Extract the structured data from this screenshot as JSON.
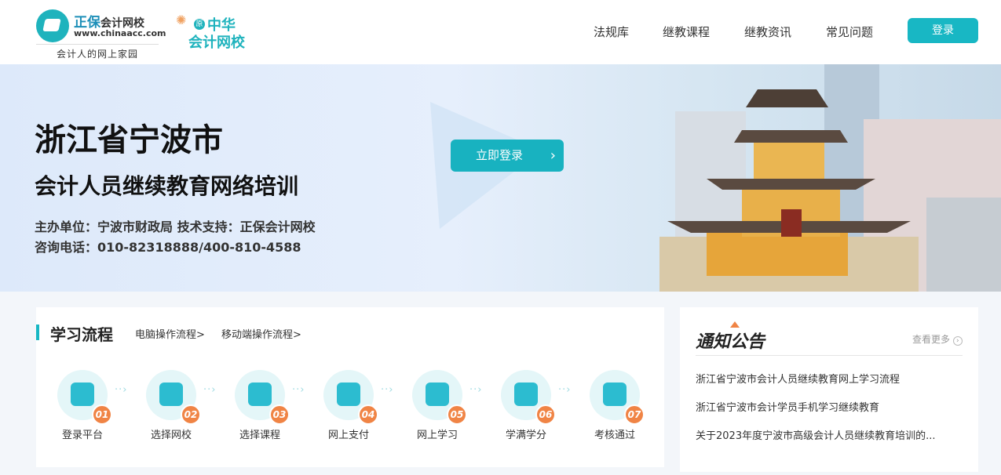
{
  "header": {
    "logo": {
      "brand": "正保",
      "brand_suffix": "会计网校",
      "url": "www.chinaacc.com",
      "slogan": "会计人的网上家园"
    },
    "sub_logo": {
      "badge": "原",
      "line1": "中华",
      "line2": "会计网校"
    },
    "nav": [
      "法规库",
      "继教课程",
      "继教资讯",
      "常见问题"
    ],
    "login_label": "登录"
  },
  "banner": {
    "title": "浙江省宁波市",
    "subtitle": "会计人员继续教育网络培训",
    "sponsor": "主办单位：宁波市财政局  技术支持：正保会计网校",
    "phone": "咨询电话：010-82318888/400-810-4588",
    "cta": "立即登录"
  },
  "process": {
    "title": "学习流程",
    "links": [
      "电脑操作流程>",
      "移动端操作流程>"
    ],
    "steps": [
      {
        "num": "01",
        "label": "登录平台",
        "icon": "user-icon"
      },
      {
        "num": "02",
        "label": "选择网校",
        "icon": "scroll-icon"
      },
      {
        "num": "03",
        "label": "选择课程",
        "icon": "calendar-icon"
      },
      {
        "num": "04",
        "label": "网上支付",
        "icon": "shield-check-icon"
      },
      {
        "num": "05",
        "label": "网上学习",
        "icon": "edit-icon"
      },
      {
        "num": "06",
        "label": "学满学分",
        "icon": "check-icon"
      },
      {
        "num": "07",
        "label": "考核通过",
        "icon": "search-icon"
      }
    ]
  },
  "notices": {
    "title": "通知公告",
    "more": "查看更多",
    "items": [
      "浙江省宁波市会计人员继续教育网上学习流程",
      "浙江省宁波市会计学员手机学习继续教育",
      "关于2023年度宁波市高级会计人员继续教育培训的..."
    ]
  },
  "colors": {
    "accent": "#18b7c4",
    "badge": "#f08445"
  }
}
